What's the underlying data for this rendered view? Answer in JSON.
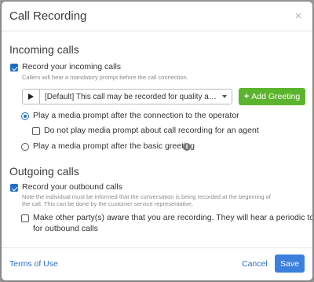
{
  "dialog": {
    "title": "Call Recording",
    "close_label": "×"
  },
  "incoming": {
    "heading": "Incoming calls",
    "record_label": "Record your incoming calls",
    "record_hint": "Callers will hear a mandatory prompt before the call connection.",
    "greeting_select": "[Default] This call may be recorded for quality ass...",
    "add_greeting_label": "Add Greeting",
    "option_after_connection": "Play a media prompt after the connection to the operator",
    "no_prompt_label": "Do not play media prompt about call recording for an agent",
    "option_after_greeting": "Play a media prompt after the basic greeting",
    "info_glyph": "i"
  },
  "outgoing": {
    "heading": "Outgoing calls",
    "record_label": "Record your outbound calls",
    "record_hint_line1": "Note the individual must be informed that the conversation is being recorded at the beginning of",
    "record_hint_line2": "the call. This can be done by the customer service representative.",
    "aware_line1": "Make other party(s) aware that you are recording. They will hear a periodic tone",
    "aware_line2": "for outbound calls"
  },
  "footer": {
    "terms_label": "Terms of Use",
    "cancel_label": "Cancel",
    "save_label": "Save"
  },
  "colors": {
    "accent_blue": "#3a80dc",
    "checkbox_blue": "#1f6fc5",
    "add_green": "#5cb42e",
    "link_blue": "#2a6fc4"
  },
  "icons": {
    "close": "close-icon",
    "play": "play-icon",
    "caret": "chevron-down-icon",
    "plus": "plus-icon",
    "info": "info-icon"
  }
}
